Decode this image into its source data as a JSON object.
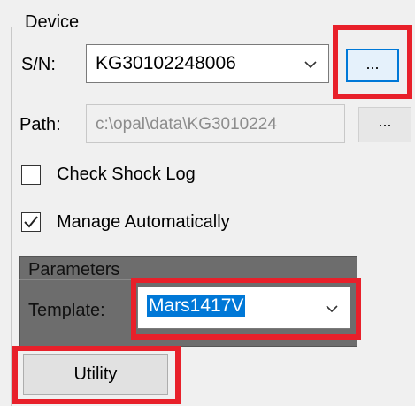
{
  "device": {
    "group_label": "Device",
    "sn_label": "S/N:",
    "sn_value": "KG30102248006",
    "sn_browse_label": "...",
    "path_label": "Path:",
    "path_value": "c:\\opal\\data\\KG3010224",
    "path_browse_label": "..."
  },
  "options": {
    "check_shock_log": {
      "label": "Check Shock Log",
      "checked": false
    },
    "manage_automatically": {
      "label": "Manage Automatically",
      "checked": true
    }
  },
  "parameters": {
    "group_label": "Parameters",
    "template_label": "Template:",
    "template_value": "Mars1417V"
  },
  "utility_button": {
    "label": "Utility"
  },
  "highlight_color": "#e8202a"
}
